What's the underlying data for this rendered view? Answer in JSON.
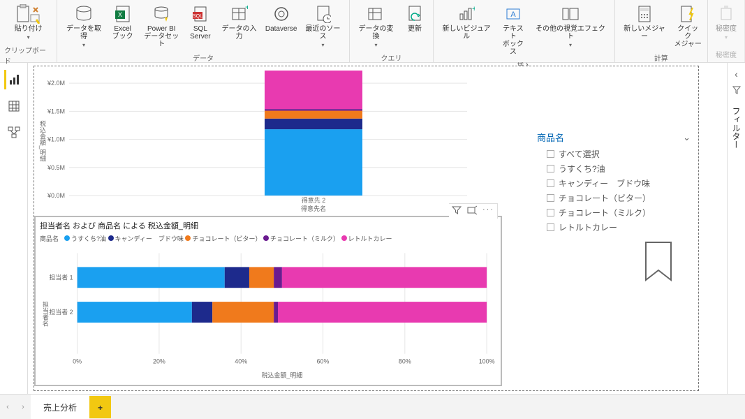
{
  "ribbon": {
    "groups": [
      {
        "label": "クリップボード",
        "buttons": [
          {
            "label": "貼り付け",
            "drop": true
          }
        ]
      },
      {
        "label": "データ",
        "buttons": [
          {
            "label": "データを取得",
            "drop": true
          },
          {
            "label": "Excel\nブック"
          },
          {
            "label": "Power BI\nデータセット"
          },
          {
            "label": "SQL\nServer"
          },
          {
            "label": "データの入力"
          },
          {
            "label": "Dataverse"
          },
          {
            "label": "最近のソース",
            "drop": true
          }
        ]
      },
      {
        "label": "クエリ",
        "buttons": [
          {
            "label": "データの変換",
            "drop": true
          },
          {
            "label": "更新"
          }
        ]
      },
      {
        "label": "挿入",
        "buttons": [
          {
            "label": "新しいビジュアル"
          },
          {
            "label": "テキスト\nボックス"
          },
          {
            "label": "その他の視覚エフェクト",
            "drop": true
          }
        ]
      },
      {
        "label": "計算",
        "buttons": [
          {
            "label": "新しいメジャー"
          },
          {
            "label": "クイック\nメジャー"
          }
        ]
      },
      {
        "label": "秘密度",
        "buttons": [
          {
            "label": "秘密度",
            "drop": true,
            "disabled": true
          }
        ]
      }
    ]
  },
  "chart_data": [
    {
      "type": "bar",
      "orientation": "vertical-stacked",
      "title": "",
      "xlabel": "得意先名",
      "ylabel": "税込金額_明細",
      "categories": [
        "得意先 2"
      ],
      "y_ticks": [
        "¥0.0M",
        "¥0.5M",
        "¥1.0M",
        "¥1.5M",
        "¥2.0M"
      ],
      "ylim": [
        0,
        2300000
      ],
      "series": [
        {
          "name": "うすくち?油",
          "color": "#1aa0f0",
          "values": [
            1180000
          ]
        },
        {
          "name": "キャンディー　ブドウ味",
          "color": "#1d2a8c",
          "values": [
            190000
          ]
        },
        {
          "name": "チョコレート（ビター）",
          "color": "#f07a1c",
          "values": [
            140000
          ]
        },
        {
          "name": "チョコレート（ミルク）",
          "color": "#6a1b8f",
          "values": [
            30000
          ]
        },
        {
          "name": "レトルトカレー",
          "color": "#e83ab0",
          "values": [
            685000
          ]
        }
      ]
    },
    {
      "type": "bar",
      "orientation": "horizontal-stacked-100pct",
      "title": "担当者名 および 商品名 による 税込金額_明細",
      "xlabel": "税込金額_明細",
      "ylabel": "担当者名",
      "legend_title": "商品名",
      "x_ticks": [
        "0%",
        "20%",
        "40%",
        "60%",
        "80%",
        "100%"
      ],
      "xlim": [
        0,
        100
      ],
      "categories": [
        "担当者 1",
        "担当者 2"
      ],
      "series": [
        {
          "name": "うすくち?油",
          "color": "#1aa0f0",
          "values": [
            36,
            28
          ]
        },
        {
          "name": "キャンディー　ブドウ味",
          "color": "#1d2a8c",
          "values": [
            6,
            5
          ]
        },
        {
          "name": "チョコレート（ビター）",
          "color": "#f07a1c",
          "values": [
            6,
            15
          ]
        },
        {
          "name": "チョコレート（ミルク）",
          "color": "#6a1b8f",
          "values": [
            2,
            1
          ]
        },
        {
          "name": "レトルトカレー",
          "color": "#e83ab0",
          "values": [
            50,
            51
          ]
        }
      ]
    }
  ],
  "slicer": {
    "title": "商品名",
    "items": [
      "すべて選択",
      "うすくち?油",
      "キャンディー　ブドウ味",
      "チョコレート（ビター）",
      "チョコレート（ミルク）",
      "レトルトカレー"
    ]
  },
  "right_rail": {
    "filters_label": "フィルター"
  },
  "tabs": {
    "active": "売上分析"
  },
  "misc": {
    "nav_prev": "‹",
    "nav_next": "›"
  }
}
